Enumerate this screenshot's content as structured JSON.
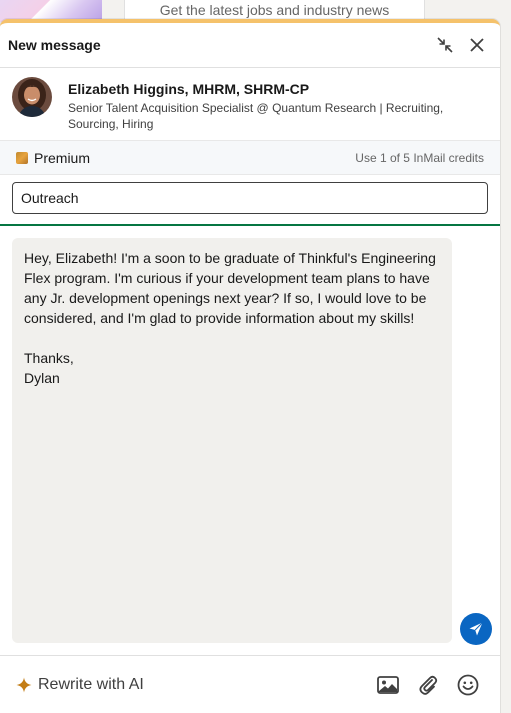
{
  "background": {
    "card_text": "Get the latest jobs and industry news"
  },
  "header": {
    "title": "New message",
    "minimize_icon": "minimize-icon",
    "close_icon": "close-icon"
  },
  "recipient": {
    "name": "Elizabeth Higgins, MHRM, SHRM-CP",
    "headline": "Senior Talent Acquisition Specialist @ Quantum Research | Recruiting, Sourcing, Hiring"
  },
  "premium": {
    "label": "Premium",
    "credits": "Use 1 of 5 InMail credits"
  },
  "subject": {
    "value": "Outreach"
  },
  "message": {
    "body": "Hey, Elizabeth! I'm a soon to be graduate of Thinkful's Engineering Flex program. I'm curious if your development team plans to have any Jr. development openings next year? If so, I would love to be considered, and I'm glad to provide information about my skills!\n\nThanks,\nDylan"
  },
  "footer": {
    "rewrite_label": "Rewrite with AI"
  },
  "colors": {
    "accent": "#0a66c2",
    "premium_gold": "#e7a33e",
    "focus_green": "#057642"
  }
}
